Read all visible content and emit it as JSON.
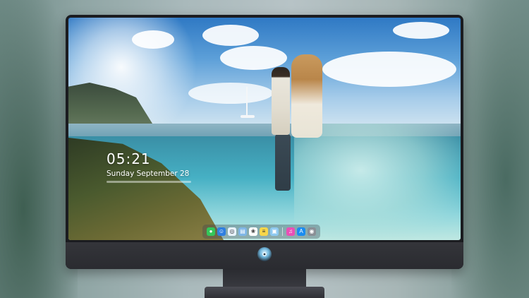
{
  "lock_screen": {
    "time": "05:21",
    "date": "Sunday September 28"
  },
  "dock": {
    "apps": [
      {
        "name": "messages-icon",
        "glyph": "●",
        "color": "#34c759"
      },
      {
        "name": "finder-icon",
        "glyph": "☺",
        "color": "#2f7fe0"
      },
      {
        "name": "safari-icon",
        "glyph": "◎",
        "color": "#e9f3ff"
      },
      {
        "name": "files-icon",
        "glyph": "▤",
        "color": "#7fb6e6"
      },
      {
        "name": "photos-icon",
        "glyph": "❀",
        "color": "#ffffff"
      },
      {
        "name": "notes-icon",
        "glyph": "≡",
        "color": "#f7d64a"
      },
      {
        "name": "preview-icon",
        "glyph": "▣",
        "color": "#8ec9f0"
      },
      {
        "name": "itunes-icon",
        "glyph": "♫",
        "color": "#ea4fb6"
      },
      {
        "name": "app-store-icon",
        "glyph": "A",
        "color": "#1a8cf0"
      },
      {
        "name": "camera-icon",
        "glyph": "◉",
        "color": "#8a8f96"
      }
    ]
  },
  "colors": {
    "monitor_bezel": "#1b1c20",
    "monitor_chin": "#2a2b30",
    "sky": "#2f79c4",
    "water": "#46b0c4"
  }
}
